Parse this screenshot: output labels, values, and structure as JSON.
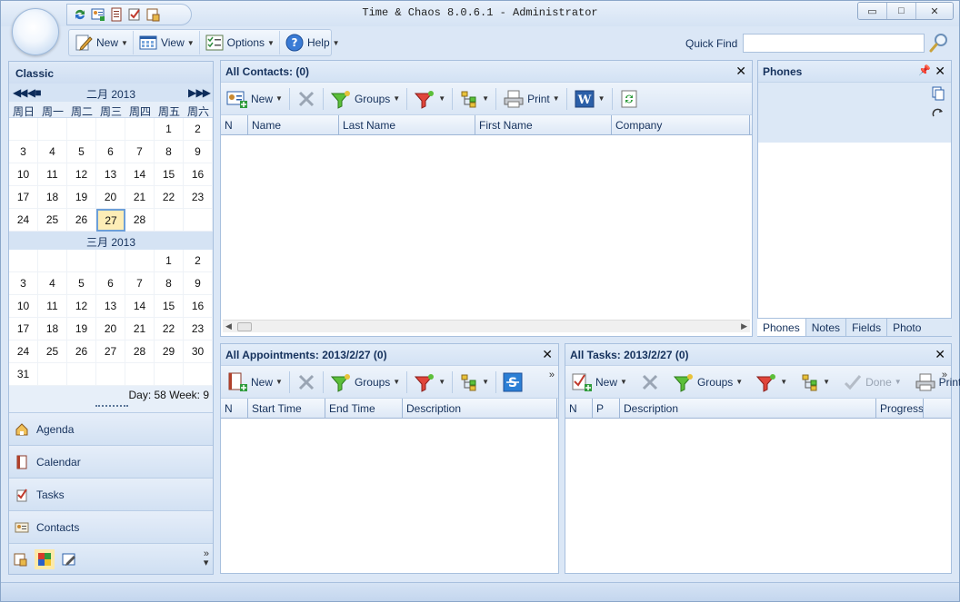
{
  "window": {
    "title": "Time & Chaos 8.0.6.1 - Administrator",
    "buttons": {
      "minimize": "▭",
      "maximize": "□",
      "close": "✕"
    }
  },
  "menu": {
    "new_label": "New",
    "view_label": "View",
    "options_label": "Options",
    "help_label": "Help"
  },
  "quickfind": {
    "label": "Quick Find",
    "value": ""
  },
  "left": {
    "header": "Classic",
    "cal1": {
      "month": "二月 2013",
      "dow": [
        "周日",
        "周一",
        "周二",
        "周三",
        "周四",
        "周五",
        "周六"
      ],
      "days": [
        "",
        "",
        "",
        "",
        "",
        "1",
        "2",
        "3",
        "4",
        "5",
        "6",
        "7",
        "8",
        "9",
        "10",
        "11",
        "12",
        "13",
        "14",
        "15",
        "16",
        "17",
        "18",
        "19",
        "20",
        "21",
        "22",
        "23",
        "24",
        "25",
        "26",
        "27",
        "28",
        "",
        ""
      ],
      "today": "27"
    },
    "cal2": {
      "month": "三月 2013",
      "days": [
        "",
        "",
        "",
        "",
        "",
        "1",
        "2",
        "3",
        "4",
        "5",
        "6",
        "7",
        "8",
        "9",
        "10",
        "11",
        "12",
        "13",
        "14",
        "15",
        "16",
        "17",
        "18",
        "19",
        "20",
        "21",
        "22",
        "23",
        "24",
        "25",
        "26",
        "27",
        "28",
        "29",
        "30",
        "31",
        "",
        "",
        "",
        "",
        "",
        ""
      ]
    },
    "daywk": "Day: 58  Week: 9",
    "nav": [
      "Agenda",
      "Calendar",
      "Tasks",
      "Contacts"
    ],
    "more": "»"
  },
  "contacts": {
    "title": "All Contacts:  (0)",
    "toolbar": {
      "new": "New",
      "groups": "Groups",
      "print": "Print"
    },
    "columns": [
      "N",
      "Name",
      "Last Name",
      "First Name",
      "Company"
    ]
  },
  "phones": {
    "title": "Phones",
    "tabs": [
      "Phones",
      "Notes",
      "Fields",
      "Photo"
    ]
  },
  "appointments": {
    "title": "All Appointments: 2013/2/27  (0)",
    "toolbar": {
      "new": "New",
      "groups": "Groups"
    },
    "columns": [
      "N",
      "Start Time",
      "End Time",
      "Description"
    ]
  },
  "tasks": {
    "title": "All Tasks: 2013/2/27  (0)",
    "toolbar": {
      "new": "New",
      "groups": "Groups",
      "done": "Done",
      "print": "Print"
    },
    "columns": [
      "N",
      "P",
      "Description",
      "Progress"
    ]
  }
}
